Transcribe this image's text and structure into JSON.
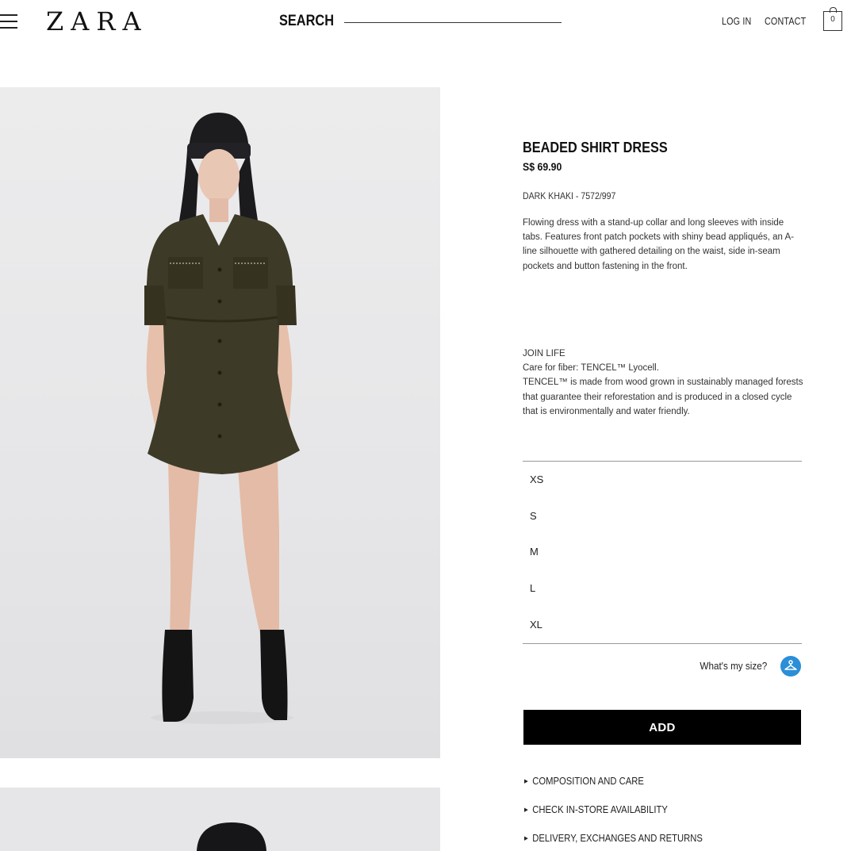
{
  "header": {
    "logo": "ZARA",
    "search_label": "SEARCH",
    "login_label": "LOG IN",
    "contact_label": "CONTACT",
    "cart_count": "0"
  },
  "product": {
    "title": "BEADED SHIRT DRESS",
    "price": "S$ 69.90",
    "color_ref": "DARK KHAKI - 7572/997",
    "description": "Flowing dress with a stand-up collar and long sleeves with inside tabs. Features front patch pockets with shiny bead appliqués, an A-line silhouette with gathered detailing on the waist, side in-seam pockets and button fastening in the front.",
    "join_life": {
      "heading": "JOIN LIFE",
      "care": "Care for fiber: TENCEL™ Lyocell.",
      "text": "TENCEL™ is made from wood grown in sustainably managed forests that guarantee their reforestation and is produced in a closed cycle that is environmentally and water friendly."
    },
    "sizes": [
      "XS",
      "S",
      "M",
      "L",
      "XL"
    ],
    "size_help": "What's my size?",
    "add_label": "ADD",
    "info_links": [
      "COMPOSITION AND CARE",
      "CHECK IN-STORE AVAILABILITY",
      "DELIVERY, EXCHANGES AND RETURNS"
    ]
  },
  "colors": {
    "dress": "#3d3b27",
    "accent_blue": "#2b8ed8",
    "button": "#000000",
    "background": "#e6e6e8"
  },
  "icons": [
    "menu-icon",
    "cart-icon",
    "hanger-icon"
  ]
}
